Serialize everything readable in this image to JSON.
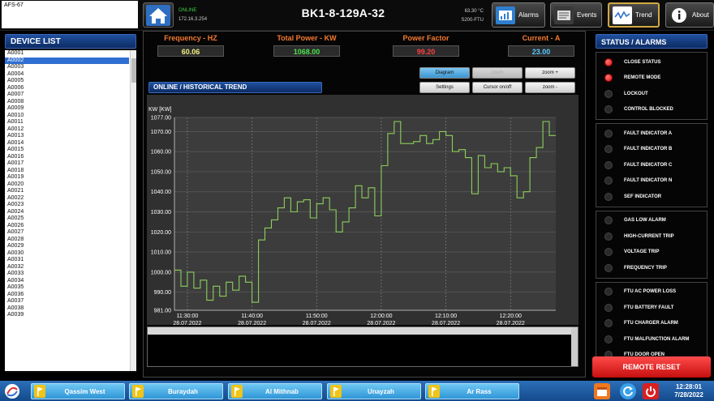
{
  "header": {
    "device_id": "AFS-67",
    "connection_status": "ONLINE",
    "ip_address": "172.16.3.254",
    "station_title": "BK1-8-129A-32",
    "temperature": "63.30 °C",
    "rtu_model": "S200-FTU",
    "nav": {
      "alarms": "Alarms",
      "events": "Events",
      "trend": "Trend",
      "about": "About"
    }
  },
  "device_list": {
    "title": "DEVICE LIST",
    "selected": "A0002",
    "items": [
      "A0001",
      "A0002",
      "A0003",
      "A0004",
      "A0005",
      "A0006",
      "A0007",
      "A0008",
      "A0009",
      "A0010",
      "A0011",
      "A0012",
      "A0013",
      "A0014",
      "A0015",
      "A0016",
      "A0017",
      "A0018",
      "A0019",
      "A0020",
      "A0021",
      "A0022",
      "A0023",
      "A0024",
      "A0025",
      "A0026",
      "A0027",
      "A0028",
      "A0029",
      "A0030",
      "A0031",
      "A0032",
      "A0033",
      "A0034",
      "A0035",
      "A0036",
      "A0037",
      "A0038",
      "A0039"
    ]
  },
  "metrics": {
    "frequency": {
      "label": "Frequency - HZ",
      "value": "60.06",
      "color": "#f0f080"
    },
    "total_power": {
      "label": "Total Power - KW",
      "value": "1068.00",
      "color": "#4be04b"
    },
    "power_factor": {
      "label": "Power Factor",
      "value": "99.20",
      "color": "#ff4040"
    },
    "current": {
      "label": "Current - A",
      "value": "23.00",
      "color": "#58c8ff"
    }
  },
  "trend": {
    "title": "ONLINE / HISTORICAL TREND",
    "buttons": {
      "diagram": "Diagram",
      "zoom_label": "zoom",
      "zoom_in": "zoom +",
      "settings": "Settings",
      "cursor": "Cursor on/off",
      "zoom_out": "zoom -"
    }
  },
  "chart_data": {
    "type": "line",
    "ylabel": "KW [KW]",
    "ylim": [
      981,
      1077
    ],
    "y_ticks": [
      1077,
      1070,
      1060,
      1050,
      1040,
      1030,
      1020,
      1010,
      1000,
      990,
      981
    ],
    "y_tick_labels": [
      "1077.00",
      "1070.00",
      "1060.00",
      "1050.00",
      "1040.00",
      "1030.00",
      "1020.00",
      "1010.00",
      "1000.00",
      "990.00",
      "981.00"
    ],
    "x_ticks": [
      2,
      12,
      22,
      32,
      42,
      52
    ],
    "x_tick_labels": [
      [
        "11:30:00",
        "28.07.2022"
      ],
      [
        "11:40:00",
        "28.07.2022"
      ],
      [
        "11:50:00",
        "28.07.2022"
      ],
      [
        "12:00:00",
        "28.07.2022"
      ],
      [
        "12:10:00",
        "28.07.2022"
      ],
      [
        "12:20:00",
        "28.07.2022"
      ]
    ],
    "xlim": [
      0,
      59
    ],
    "grid": true,
    "line_color": "#8bcf5a",
    "series": [
      {
        "values": [
          1001,
          993,
          1000,
          992,
          996,
          986,
          993,
          988,
          995,
          991,
          998,
          995,
          985,
          1016,
          1022,
          1026,
          1032,
          1037,
          1030,
          1035,
          1036,
          1027,
          1034,
          1037,
          1031,
          1020,
          1025,
          1032,
          1043,
          1037,
          1042,
          1028,
          1053,
          1069,
          1075,
          1064,
          1064,
          1065,
          1068,
          1064,
          1066,
          1070,
          1068,
          1060,
          1061,
          1057,
          1039,
          1058,
          1052,
          1054,
          1050,
          1052,
          1048,
          1037,
          1040,
          1057,
          1062,
          1075,
          1068
        ]
      }
    ]
  },
  "status": {
    "title": "STATUS / ALARMS",
    "groups": [
      {
        "items": [
          {
            "label": "CLOSE STATUS",
            "on": true
          },
          {
            "label": "REMOTE MODE",
            "on": true
          },
          {
            "label": "LOCKOUT",
            "on": false
          },
          {
            "label": "CONTROL BLOCKED",
            "on": false
          }
        ]
      },
      {
        "items": [
          {
            "label": "FAULT INDICATOR A",
            "on": false
          },
          {
            "label": "FAULT INDICATOR B",
            "on": false
          },
          {
            "label": "FAULT INDICATOR C",
            "on": false
          },
          {
            "label": "FAULT INDICATOR N",
            "on": false
          },
          {
            "label": "SEF INDICATOR",
            "on": false
          }
        ]
      },
      {
        "items": [
          {
            "label": "GAS LOW ALARM",
            "on": false
          },
          {
            "label": "HIGH-CURRENT TRIP",
            "on": false
          },
          {
            "label": "VOLTAGE TRIP",
            "on": false
          },
          {
            "label": "FREQUENCY TRIP",
            "on": false
          }
        ]
      },
      {
        "items": [
          {
            "label": "FTU AC POWER LOSS",
            "on": false
          },
          {
            "label": "FTU BATTERY FAULT",
            "on": false
          },
          {
            "label": "FTU CHARGER ALARM",
            "on": false
          },
          {
            "label": "FTU MALFUNCTION ALARM",
            "on": false
          },
          {
            "label": "FTU DOOR OPEN",
            "on": false
          }
        ]
      }
    ],
    "remote_reset": "REMOTE RESET"
  },
  "taskbar": {
    "regions": [
      "Qassim West",
      "Buraydah",
      "Al Mithnab",
      "Unayzah",
      "Ar Rass"
    ],
    "time": "12:28:01",
    "date": "7/28/2022"
  }
}
